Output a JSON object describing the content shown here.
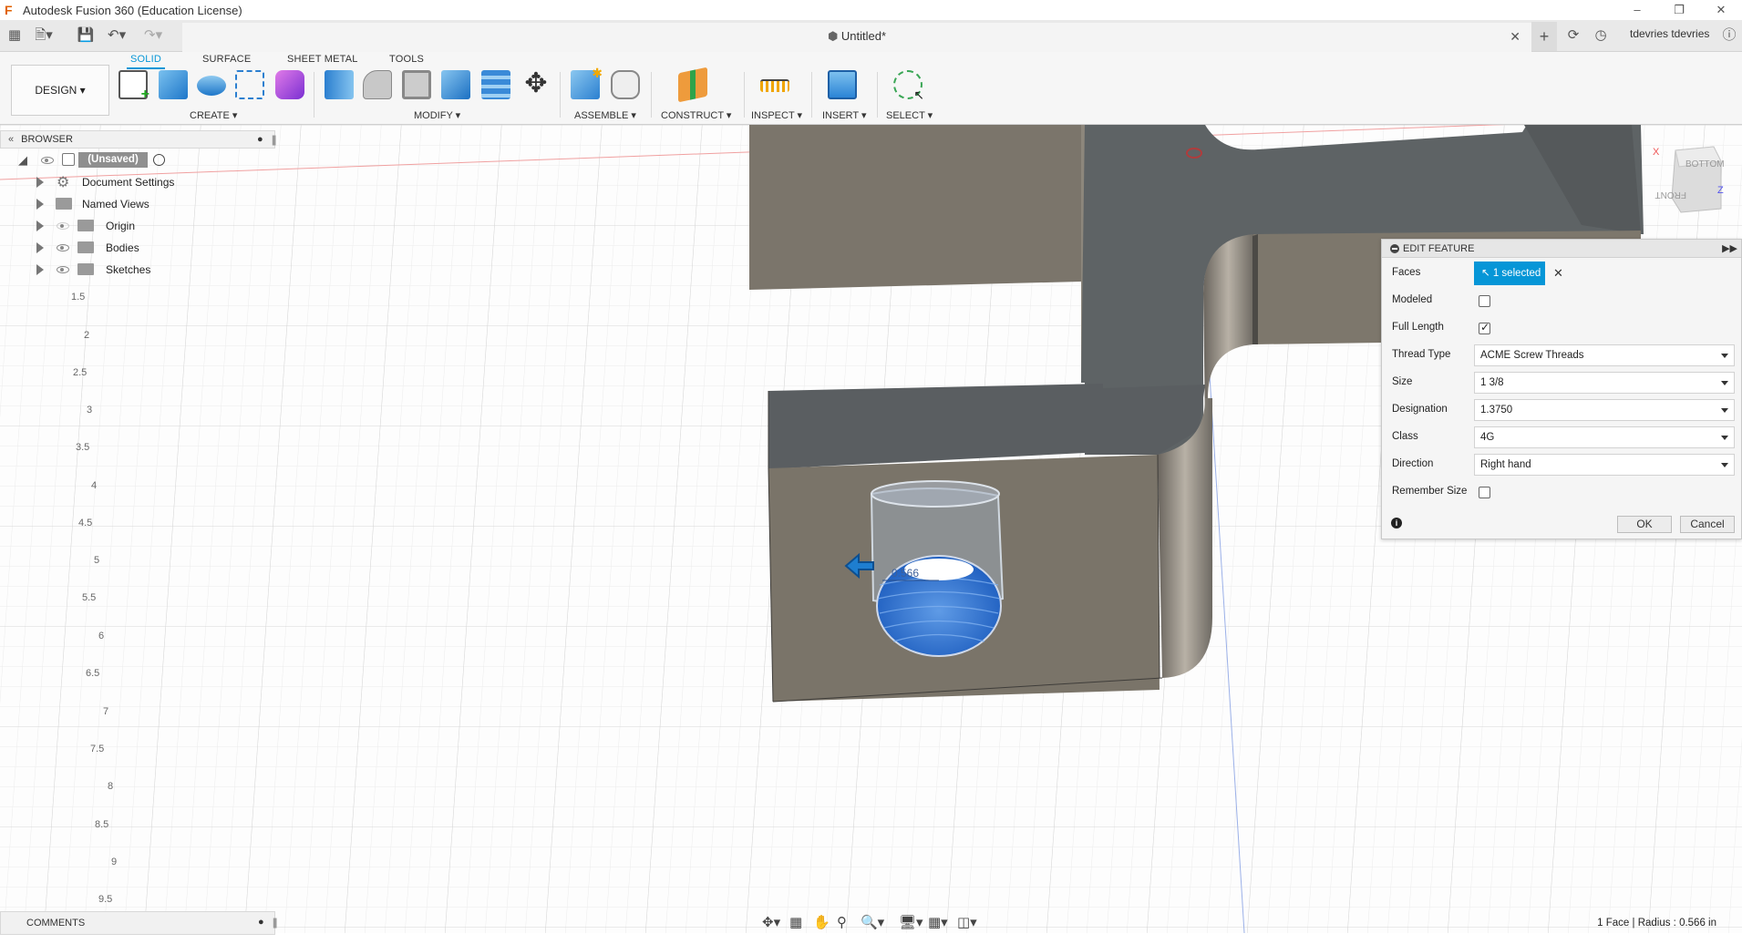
{
  "window": {
    "title": "Autodesk Fusion 360 (Education License)"
  },
  "document_tab": {
    "title": "Untitled*"
  },
  "user": {
    "name": "tdevries tdevries"
  },
  "ribbon": {
    "tabs": [
      "SOLID",
      "SURFACE",
      "SHEET METAL",
      "TOOLS"
    ],
    "active_tab": "SOLID",
    "workspace": "DESIGN",
    "groups": [
      "CREATE",
      "MODIFY",
      "ASSEMBLE",
      "CONSTRUCT",
      "INSPECT",
      "INSERT",
      "SELECT"
    ]
  },
  "browser": {
    "header": "BROWSER",
    "root": "(Unsaved)",
    "items": [
      "Document Settings",
      "Named Views",
      "Origin",
      "Bodies",
      "Sketches"
    ]
  },
  "edit_feature": {
    "title": "EDIT FEATURE",
    "faces_label": "Faces",
    "faces_value": "1 selected",
    "modeled_label": "Modeled",
    "modeled_checked": false,
    "full_length_label": "Full Length",
    "full_length_checked": true,
    "thread_type_label": "Thread Type",
    "thread_type_value": "ACME Screw Threads",
    "size_label": "Size",
    "size_value": "1 3/8",
    "designation_label": "Designation",
    "designation_value": "1.3750",
    "class_label": "Class",
    "class_value": "4G",
    "direction_label": "Direction",
    "direction_value": "Right hand",
    "remember_size_label": "Remember Size",
    "remember_size_checked": false,
    "ok_label": "OK",
    "cancel_label": "Cancel"
  },
  "viewport": {
    "dimension_label": "0.566",
    "viewcube": {
      "top_face": "BOTTOM",
      "front_face": "FRONT",
      "axis_x": "X",
      "axis_z": "Z"
    },
    "ruler_ticks": [
      "1.5",
      "2",
      "2.5",
      "3",
      "3.5",
      "4",
      "4.5",
      "5",
      "5.5",
      "6",
      "6.5",
      "7",
      "7.5",
      "8",
      "8.5",
      "9",
      "9.5"
    ]
  },
  "comments": {
    "label": "COMMENTS"
  },
  "status_bar": {
    "text": "1 Face | Radius : 0.566 in"
  },
  "colors": {
    "accent": "#0696d7",
    "body": "#7c7468",
    "body_dark": "#5d6062",
    "thread": "#3a78d0"
  }
}
